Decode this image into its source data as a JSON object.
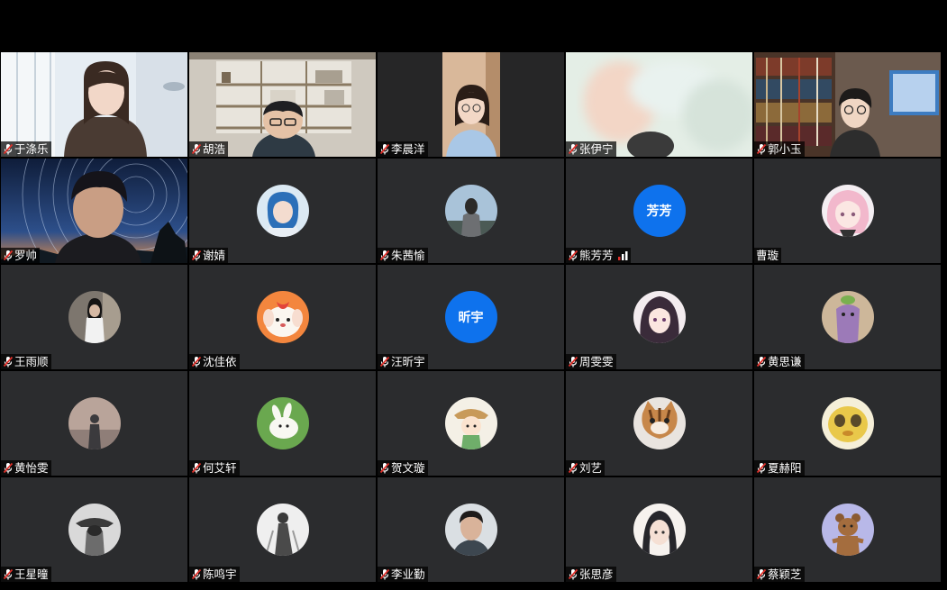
{
  "meeting": {
    "participants": [
      {
        "name": "于涤乐",
        "muted": true,
        "video": "room-window"
      },
      {
        "name": "胡浩",
        "muted": true,
        "video": "bookshelf-room"
      },
      {
        "name": "李晨洋",
        "muted": true,
        "video": "girl-door"
      },
      {
        "name": "张伊宁",
        "muted": true,
        "video": "blurred-light"
      },
      {
        "name": "郭小玉",
        "muted": true,
        "video": "library-shelf"
      },
      {
        "name": "罗帅",
        "muted": true,
        "video": "star-trails"
      },
      {
        "name": "谢婧",
        "muted": true,
        "avatar": "blue-hair-photo"
      },
      {
        "name": "朱茜愉",
        "muted": true,
        "avatar": "back-view-photo"
      },
      {
        "name": "熊芳芳",
        "muted": true,
        "avatar_text": "芳芳",
        "signal": true
      },
      {
        "name": "曹璇",
        "muted": false,
        "avatar": "pink-hair-illustration"
      },
      {
        "name": "王雨顺",
        "muted": true,
        "avatar": "dark-hair-photo"
      },
      {
        "name": "沈佳依",
        "muted": true,
        "avatar": "puppy-cartoon"
      },
      {
        "name": "汪昕宇",
        "muted": true,
        "avatar_text": "昕宇"
      },
      {
        "name": "周雯雯",
        "muted": true,
        "avatar": "anime-girl"
      },
      {
        "name": "黄思谦",
        "muted": true,
        "avatar": "purple-plush"
      },
      {
        "name": "黄怡雯",
        "muted": true,
        "avatar": "seaside-figure"
      },
      {
        "name": "何艾轩",
        "muted": true,
        "avatar": "white-bunny-green"
      },
      {
        "name": "贺文璇",
        "muted": true,
        "avatar": "straw-hat-boy"
      },
      {
        "name": "刘艺",
        "muted": true,
        "avatar": "tabby-cat"
      },
      {
        "name": "夏赫阳",
        "muted": true,
        "avatar": "yellow-cartoon-face"
      },
      {
        "name": "王星曈",
        "muted": true,
        "avatar": "hat-figure"
      },
      {
        "name": "陈鸣宇",
        "muted": true,
        "avatar": "sketch-figure"
      },
      {
        "name": "李业勤",
        "muted": true,
        "avatar": "young-man-photo"
      },
      {
        "name": "张思彦",
        "muted": true,
        "avatar": "anime-boy"
      },
      {
        "name": "蔡颖芝",
        "muted": true,
        "avatar": "brown-bear"
      }
    ]
  },
  "colors": {
    "tile_bg": "#2b2c2e",
    "text_avatar_bg": "#0e72ed",
    "muted_icon": "#e0312b"
  }
}
